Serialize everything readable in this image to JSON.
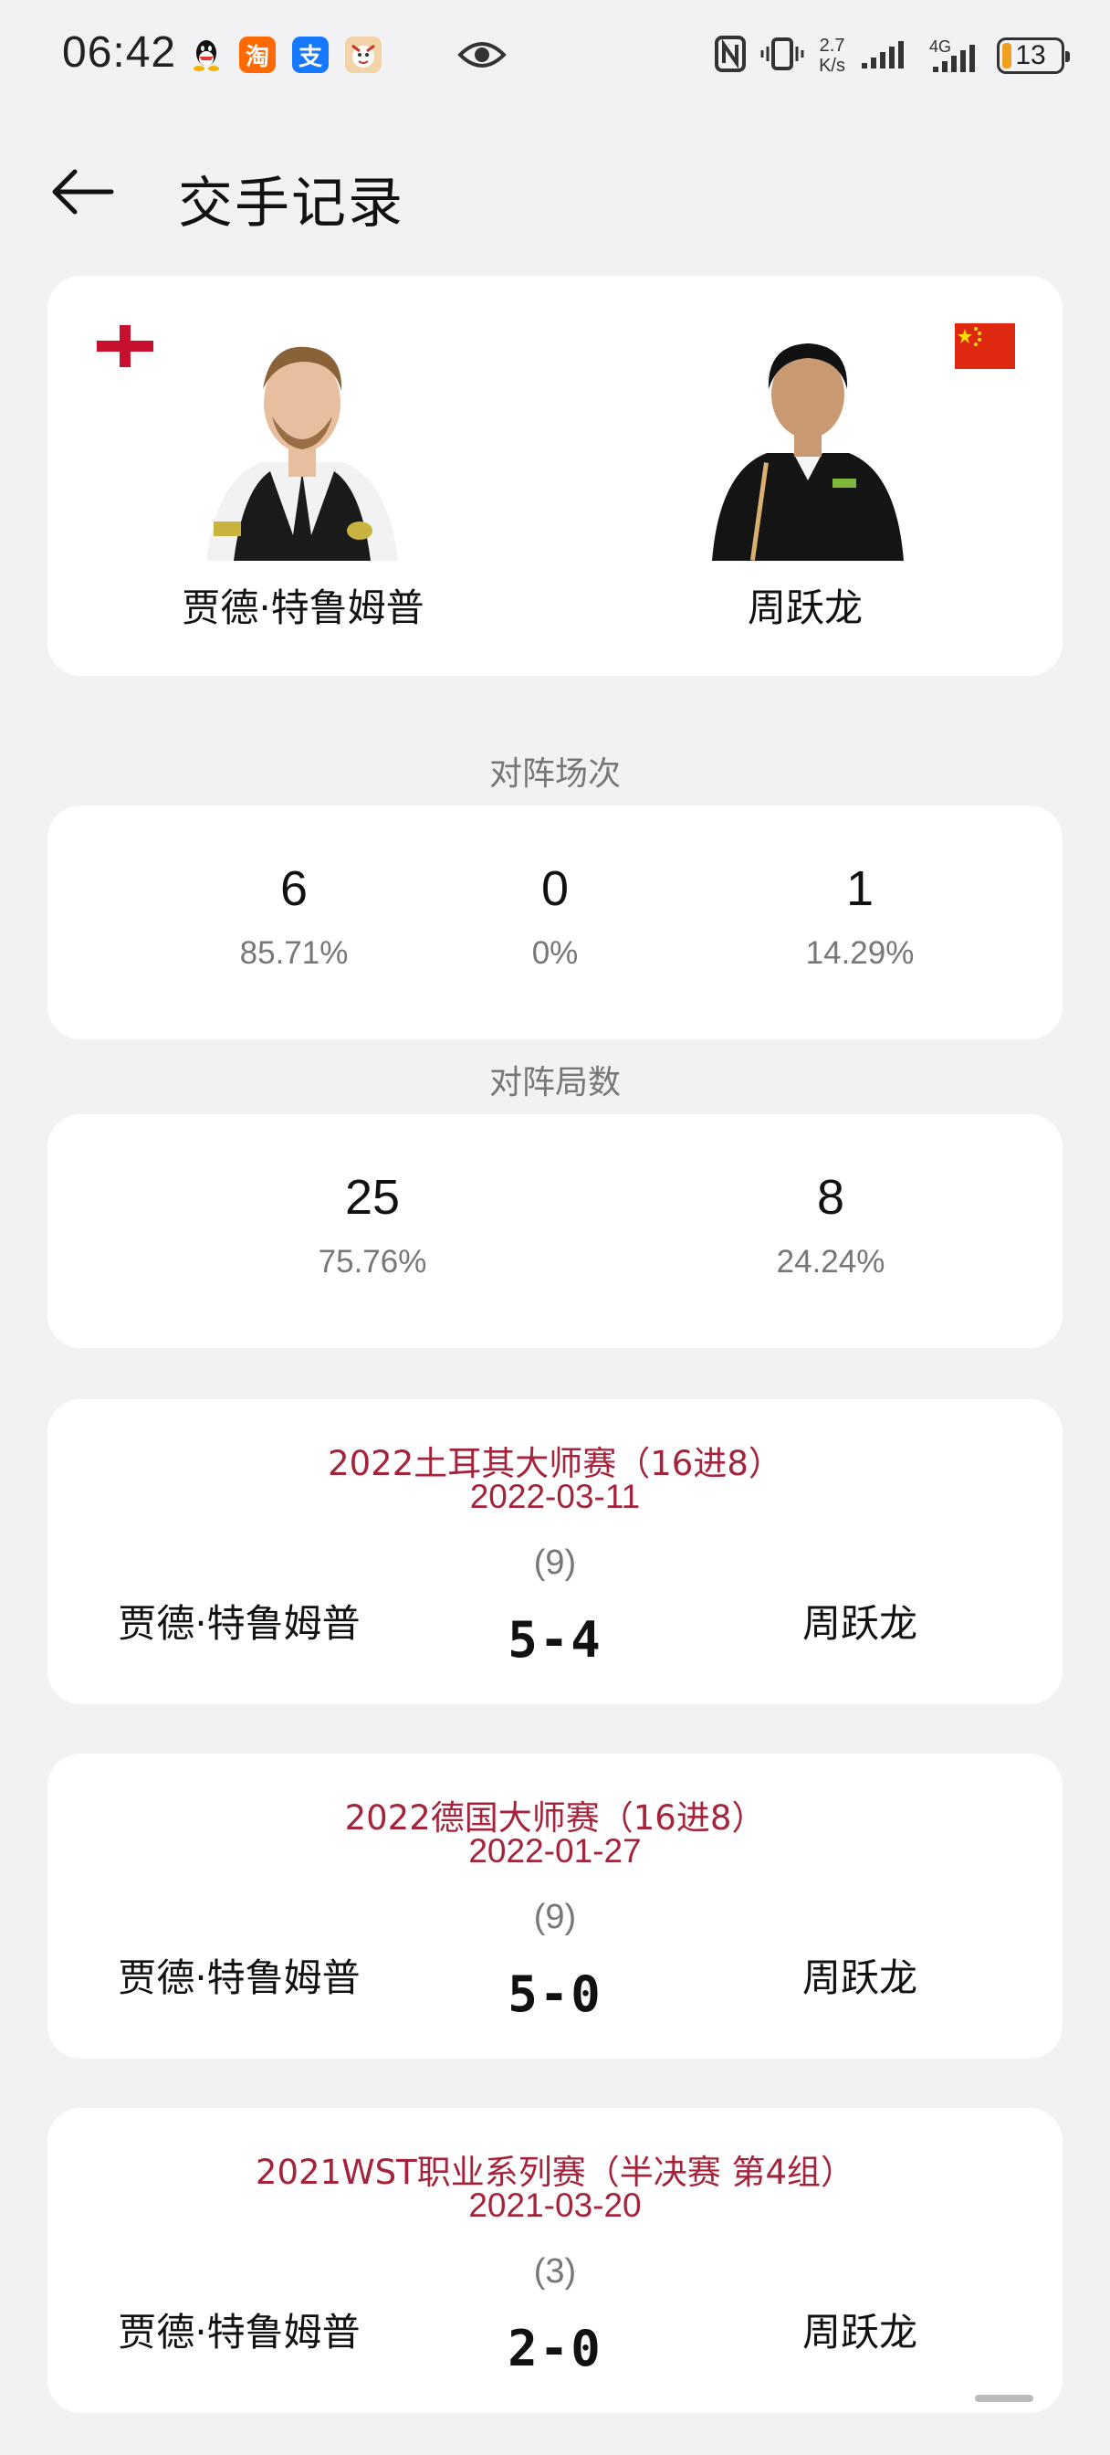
{
  "status_bar": {
    "time": "06:42",
    "net_speed_value": "2.7",
    "net_speed_unit": "K/s",
    "network_type": "4G",
    "battery": "13"
  },
  "header": {
    "title": "交手记录"
  },
  "players": {
    "left": {
      "name": "贾德·特鲁姆普",
      "flag": "england-flag-icon"
    },
    "right": {
      "name": "周跃龙",
      "flag": "china-flag-icon"
    }
  },
  "matches_summary": {
    "label": "对阵场次",
    "left": {
      "value": "6",
      "percent": "85.71%"
    },
    "draw": {
      "value": "0",
      "percent": "0%"
    },
    "right": {
      "value": "1",
      "percent": "14.29%"
    }
  },
  "frames_summary": {
    "label": "对阵局数",
    "left": {
      "value": "25",
      "percent": "75.76%"
    },
    "right": {
      "value": "8",
      "percent": "24.24%"
    }
  },
  "match_records": [
    {
      "event": "2022土耳其大师赛（16进8）",
      "date": "2022-03-11",
      "best_of": "(9)",
      "player1": "贾德·特鲁姆普",
      "score": "5-4",
      "player2": "周跃龙"
    },
    {
      "event": "2022德国大师赛（16进8）",
      "date": "2022-01-27",
      "best_of": "(9)",
      "player1": "贾德·特鲁姆普",
      "score": "5-0",
      "player2": "周跃龙"
    },
    {
      "event": "2021WST职业系列赛（半决赛 第4组）",
      "date": "2021-03-20",
      "best_of": "(3)",
      "player1": "贾德·特鲁姆普",
      "score": "2-0",
      "player2": "周跃龙"
    }
  ],
  "colors": {
    "accent": "#a3243b",
    "background": "#f2f2f5",
    "card": "#ffffff"
  }
}
